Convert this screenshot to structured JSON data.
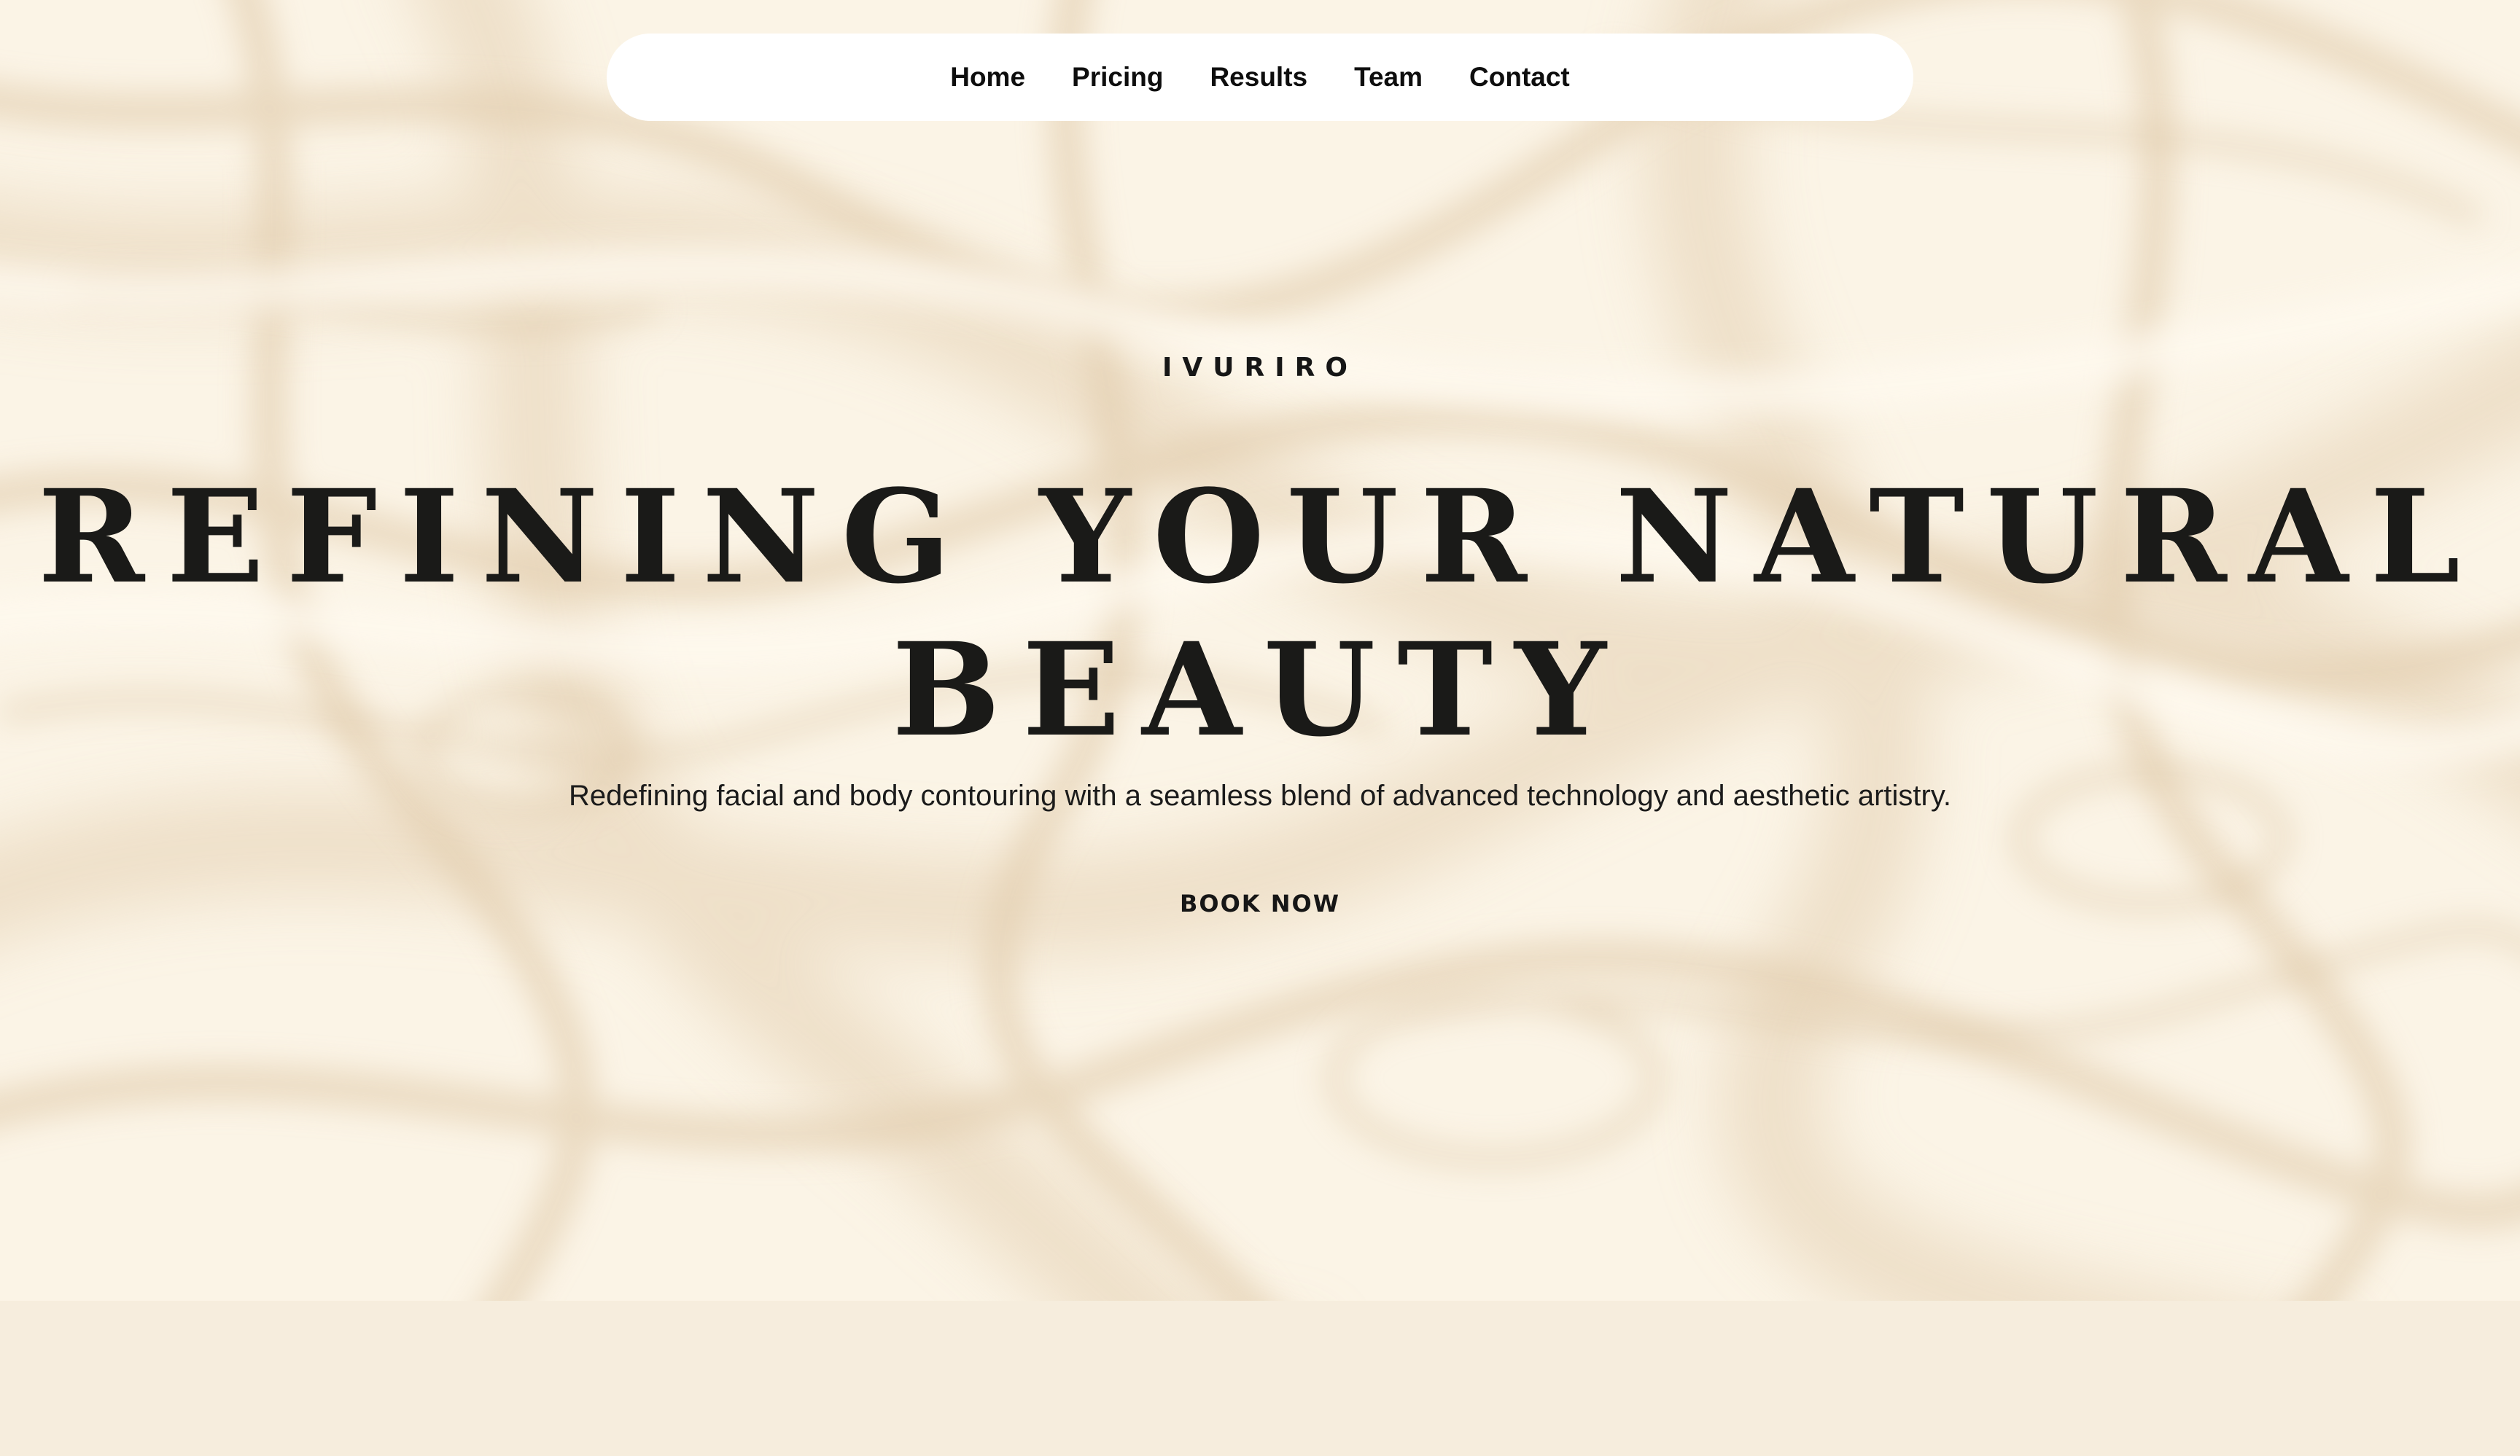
{
  "nav": {
    "items": [
      {
        "label": "Home"
      },
      {
        "label": "Pricing"
      },
      {
        "label": "Results"
      },
      {
        "label": "Team"
      },
      {
        "label": "Contact"
      }
    ]
  },
  "hero": {
    "brand": "IVURIRO",
    "headline_line1": "REFINING YOUR NATURAL",
    "headline_line2": "BEAUTY",
    "subtitle": "Redefining facial and body contouring with a seamless blend of advanced technology and aesthetic artistry.",
    "cta_label": "BOOK NOW"
  },
  "colors": {
    "background_cream": "#fbf4e6",
    "marble_swirl": "#e6d3b7",
    "below_band": "#f6eddd",
    "nav_background": "#ffffff",
    "text_dark": "#1a1a1a"
  }
}
